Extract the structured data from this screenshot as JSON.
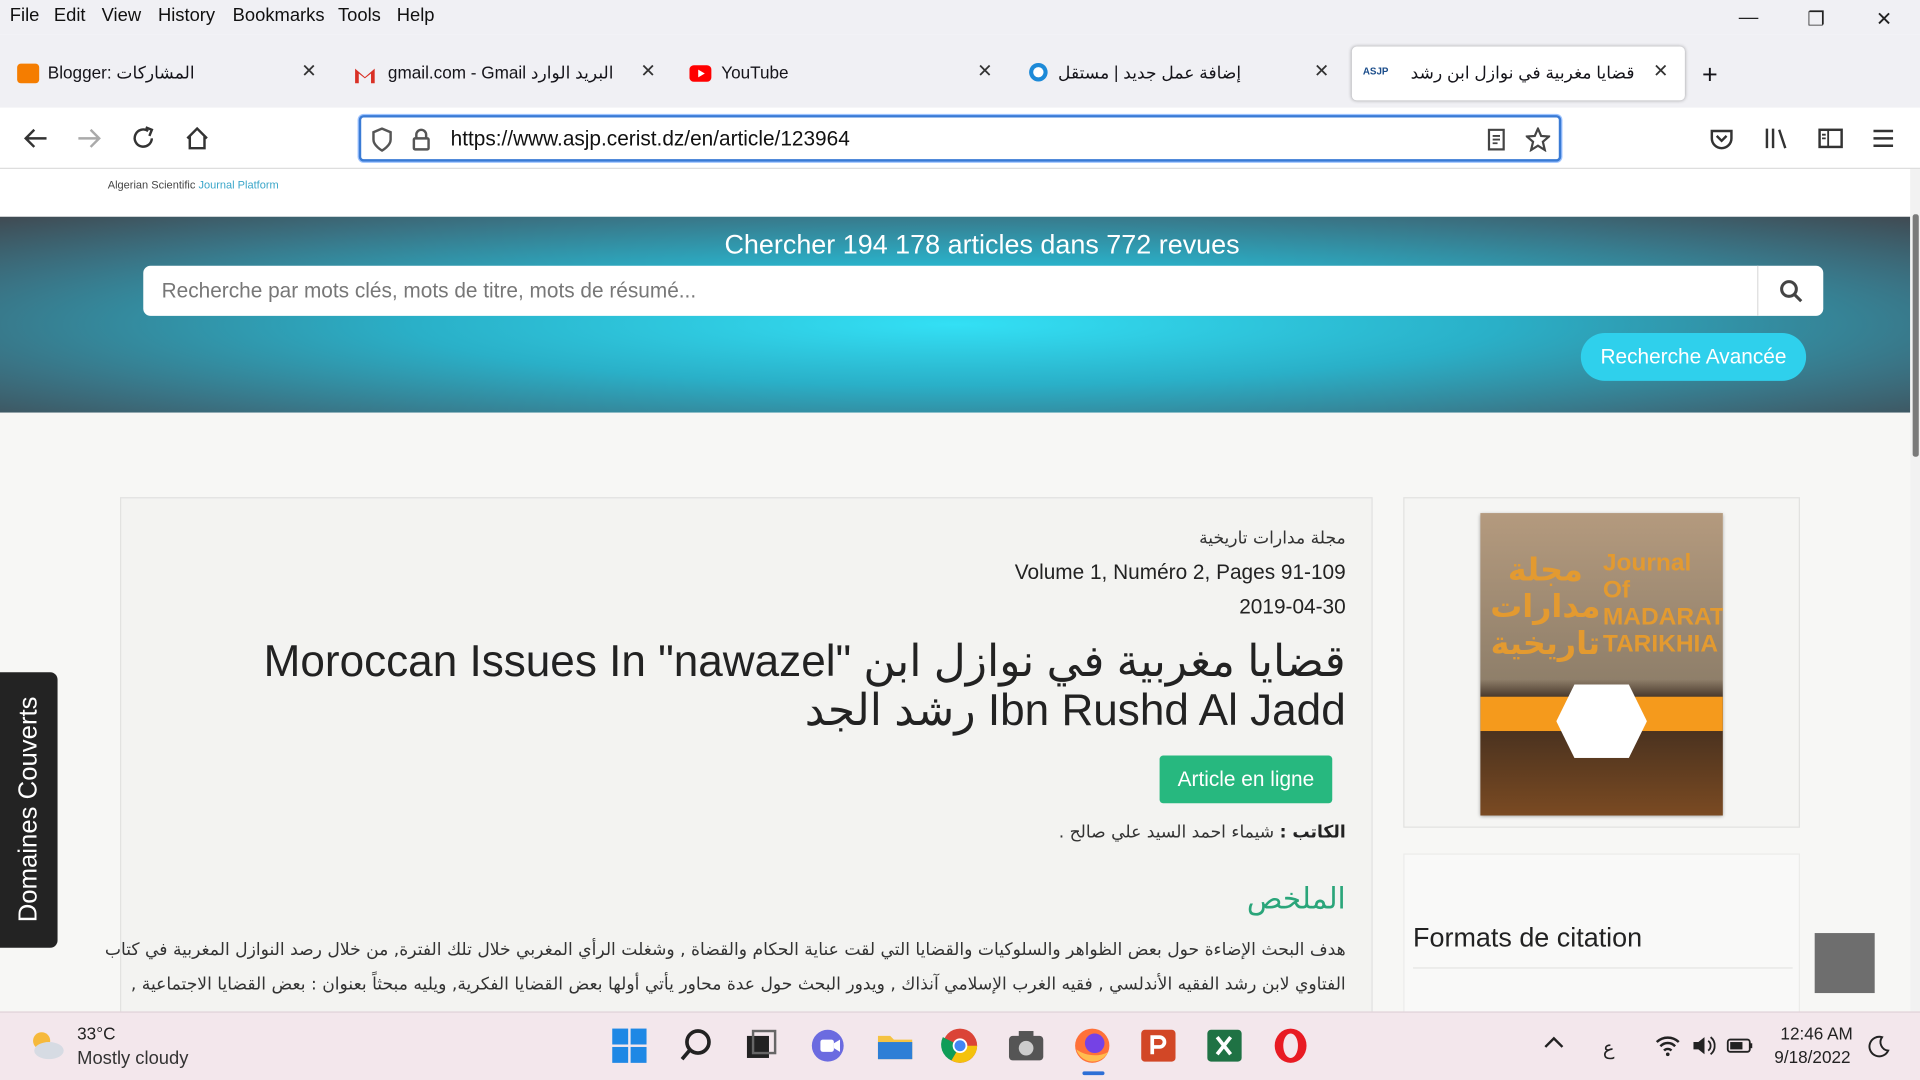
{
  "browser": {
    "menu": [
      "File",
      "Edit",
      "View",
      "History",
      "Bookmarks",
      "Tools",
      "Help"
    ],
    "window_controls": {
      "minimize": "—",
      "restore": "❐",
      "close": "✕"
    },
    "tabs": [
      {
        "title": "Blogger: المشاركات",
        "favicon": "blogger-icon",
        "color": "#f57d00"
      },
      {
        "title": " gmail.com - Gmail البريد الوارد",
        "favicon": "gmail-icon",
        "color": "#d93025"
      },
      {
        "title": "YouTube",
        "favicon": "youtube-icon",
        "color": "#ff0000"
      },
      {
        "title": "إضافة عمل جديد | مستقل",
        "favicon": "mostaql-icon",
        "color": "#1d8ad8"
      },
      {
        "title": "قضايا مغربية في نوازل ابن رشد",
        "favicon": "asjp-icon",
        "color": "#1a4c8a"
      }
    ],
    "new_tab": "+",
    "url": "https://www.asjp.cerist.dz/en/article/123964"
  },
  "site": {
    "logo_caption_1": "Algerian Scientific",
    "logo_caption_2": "Journal Platform",
    "banner_title": "Chercher 194 178 articles dans 772 revues",
    "search_placeholder": "Recherche par mots clés, mots de titre, mots de résumé...",
    "advanced_search": "Recherche Avancée",
    "domaines": "Domaines Couverts"
  },
  "article": {
    "journal": "مجلة مدارات تاريخية",
    "volume": "Volume 1, Numéro 2, Pages 91-109",
    "date": "2019-04-30",
    "title": "Moroccan Issues In \"nawazel\" قضايا مغربية في نوازل ابن رشد الجد Ibn Rushd Al Jadd",
    "online_button": "Article en ligne",
    "author_label": "الكاتب :",
    "author_name": "شيماء احمد السيد علي صالح .",
    "abstract_heading": "الملخص",
    "abstract_line1": "هدف البحث الإضاءة حول بعض الظواهر والسلوكيات والقضايا التي لقت عناية الحكام والقضاة , وشغلت الرأي المغربي خلال تلك الفترة, من خلال رصد النوازل المغربية في كتاب",
    "abstract_line2": "الفتاوي لابن رشد الفقيه الأندلسي , فقيه الغرب الإسلامي آنذاك , ويدور البحث حول عدة محاور يأتي أولها بعض القضايا الفكرية, ويليه مبحثاً بعنوان : بعض القضايا الاجتماعية ,"
  },
  "cover": {
    "arabic": "مجلة مدارات تاريخية",
    "latin": "Journal Of MADARAT TARIKHIA"
  },
  "citation": {
    "title": "Formats de citation"
  },
  "taskbar": {
    "weather_temp": "33°C",
    "weather_desc": "Mostly cloudy",
    "lang": "ع",
    "time": "12:46 AM",
    "date": "9/18/2022"
  },
  "colors": {
    "accent": "#2fd0ec",
    "online": "#27b87f",
    "abstract_heading": "#2aa57a"
  }
}
